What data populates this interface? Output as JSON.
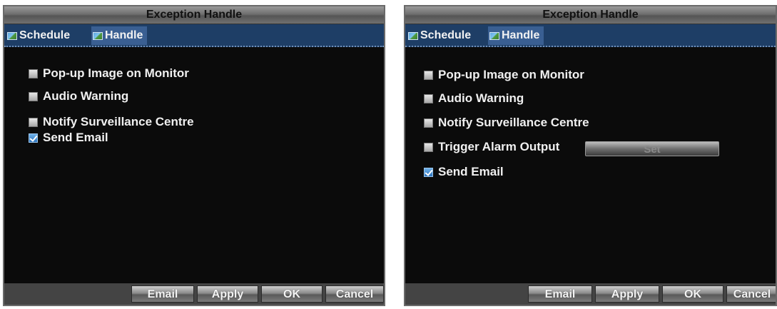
{
  "left_dialog": {
    "title": "Exception Handle",
    "tabs": [
      {
        "label": "Schedule",
        "active": false
      },
      {
        "label": "Handle",
        "active": true
      }
    ],
    "options": [
      {
        "label": "Pop-up Image on Monitor",
        "checked": false
      },
      {
        "label": "Audio Warning",
        "checked": false
      },
      {
        "label": "Notify Surveillance Centre",
        "checked": false
      },
      {
        "label": "Send Email",
        "checked": true
      }
    ],
    "buttons": {
      "email": "Email",
      "apply": "Apply",
      "ok": "OK",
      "cancel": "Cancel"
    }
  },
  "right_dialog": {
    "title": "Exception Handle",
    "tabs": [
      {
        "label": "Schedule",
        "active": false
      },
      {
        "label": "Handle",
        "active": true
      }
    ],
    "options": [
      {
        "label": "Pop-up Image on Monitor",
        "checked": false
      },
      {
        "label": "Audio Warning",
        "checked": false
      },
      {
        "label": "Notify Surveillance Centre",
        "checked": false
      },
      {
        "label": "Trigger Alarm Output",
        "checked": false
      },
      {
        "label": "Send Email",
        "checked": true
      }
    ],
    "set_button": "Set",
    "buttons": {
      "email": "Email",
      "apply": "Apply",
      "ok": "OK",
      "cancel": "Cancel"
    }
  },
  "colors": {
    "background": "#0b0b0b",
    "tab_bar": "#1e3e66",
    "tab_active": "#3a5f92",
    "checkbox_checked": "#2c73bd"
  }
}
